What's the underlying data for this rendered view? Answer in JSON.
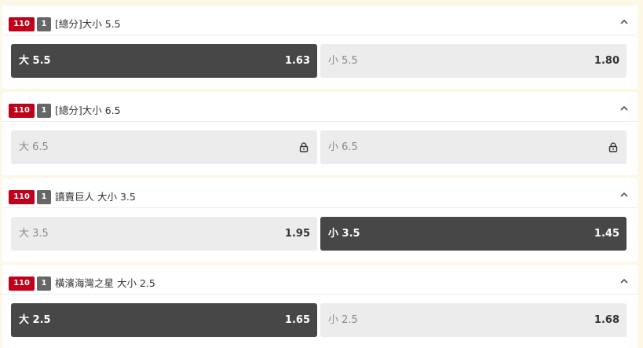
{
  "colors": {
    "page_bg": "#fdf8e6",
    "league_badge": "#c0001a",
    "period_badge": "#666666",
    "selected_option": "#474747",
    "option": "#ececec"
  },
  "markets": [
    {
      "league_code": "110",
      "period": "1",
      "title": "[總分]大小 5.5",
      "options": [
        {
          "label": "大 5.5",
          "odds": "1.63",
          "selected": true,
          "locked": false
        },
        {
          "label": "小 5.5",
          "odds": "1.80",
          "selected": false,
          "locked": false
        }
      ]
    },
    {
      "league_code": "110",
      "period": "1",
      "title": "[總分]大小 6.5",
      "options": [
        {
          "label": "大 6.5",
          "odds": "",
          "selected": false,
          "locked": true,
          "icon": "lock-icon"
        },
        {
          "label": "小 6.5",
          "odds": "",
          "selected": false,
          "locked": true,
          "icon": "lock-icon"
        }
      ]
    },
    {
      "league_code": "110",
      "period": "1",
      "title": "讀賣巨人 大小 3.5",
      "options": [
        {
          "label": "大 3.5",
          "odds": "1.95",
          "selected": false,
          "locked": false
        },
        {
          "label": "小 3.5",
          "odds": "1.45",
          "selected": true,
          "locked": false
        }
      ]
    },
    {
      "league_code": "110",
      "period": "1",
      "title": "橫濱海灣之星 大小 2.5",
      "options": [
        {
          "label": "大 2.5",
          "odds": "1.65",
          "selected": true,
          "locked": false
        },
        {
          "label": "小 2.5",
          "odds": "1.68",
          "selected": false,
          "locked": false
        }
      ]
    }
  ],
  "icons": {
    "collapse": "chevron-up-icon",
    "lock": "lock-icon"
  }
}
